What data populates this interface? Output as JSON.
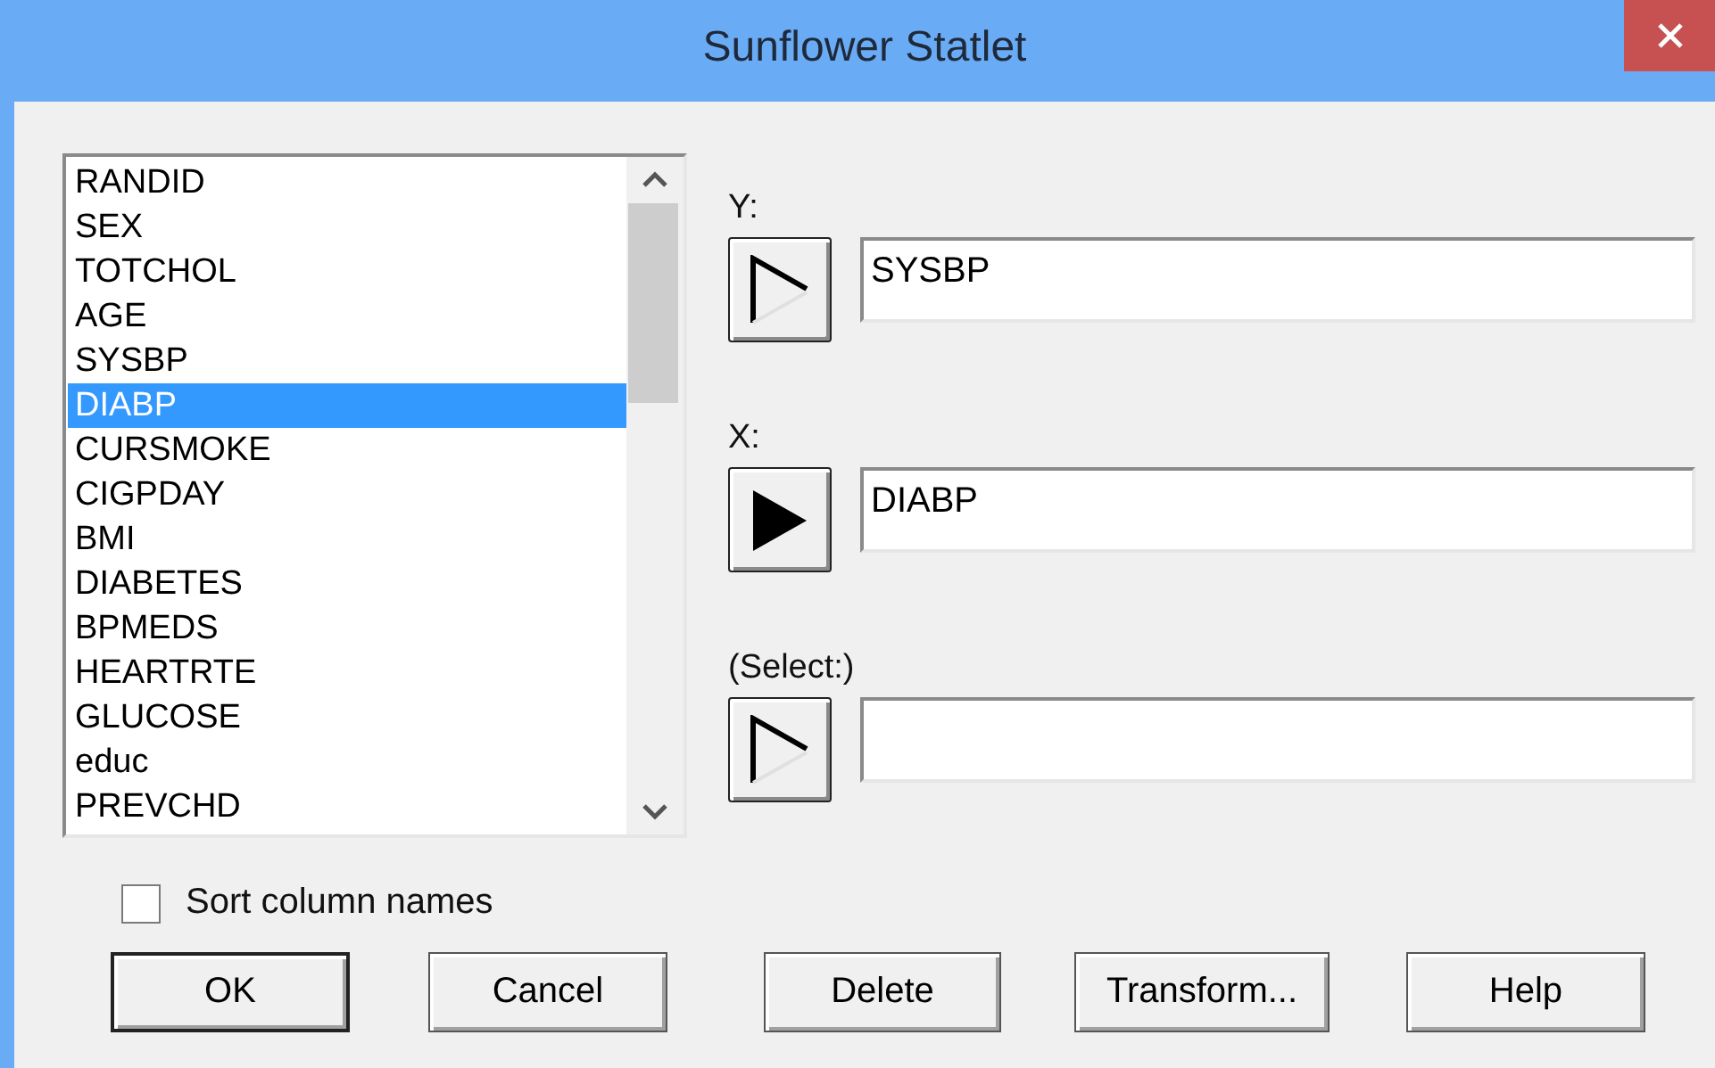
{
  "window": {
    "title": "Sunflower Statlet"
  },
  "variables": [
    {
      "name": "RANDID",
      "selected": false
    },
    {
      "name": "SEX",
      "selected": false
    },
    {
      "name": "TOTCHOL",
      "selected": false
    },
    {
      "name": "AGE",
      "selected": false
    },
    {
      "name": "SYSBP",
      "selected": false
    },
    {
      "name": "DIABP",
      "selected": true
    },
    {
      "name": "CURSMOKE",
      "selected": false
    },
    {
      "name": "CIGPDAY",
      "selected": false
    },
    {
      "name": "BMI",
      "selected": false
    },
    {
      "name": "DIABETES",
      "selected": false
    },
    {
      "name": "BPMEDS",
      "selected": false
    },
    {
      "name": "HEARTRTE",
      "selected": false
    },
    {
      "name": "GLUCOSE",
      "selected": false
    },
    {
      "name": "educ",
      "selected": false
    },
    {
      "name": "PREVCHD",
      "selected": false
    }
  ],
  "slots": [
    {
      "label": "Y:",
      "value": "SYSBP",
      "active": false
    },
    {
      "label": "X:",
      "value": "DIABP",
      "active": true
    },
    {
      "label": "(Select:)",
      "active": false
    }
  ],
  "sort_column_names": {
    "label": "Sort column names",
    "checked": false
  },
  "buttons": [
    {
      "label": "OK",
      "default": true
    },
    {
      "label": "Cancel",
      "default": false
    },
    {
      "label": "Delete",
      "default": false
    },
    {
      "label": "Transform...",
      "default": false
    },
    {
      "label": "Help",
      "default": false
    }
  ]
}
